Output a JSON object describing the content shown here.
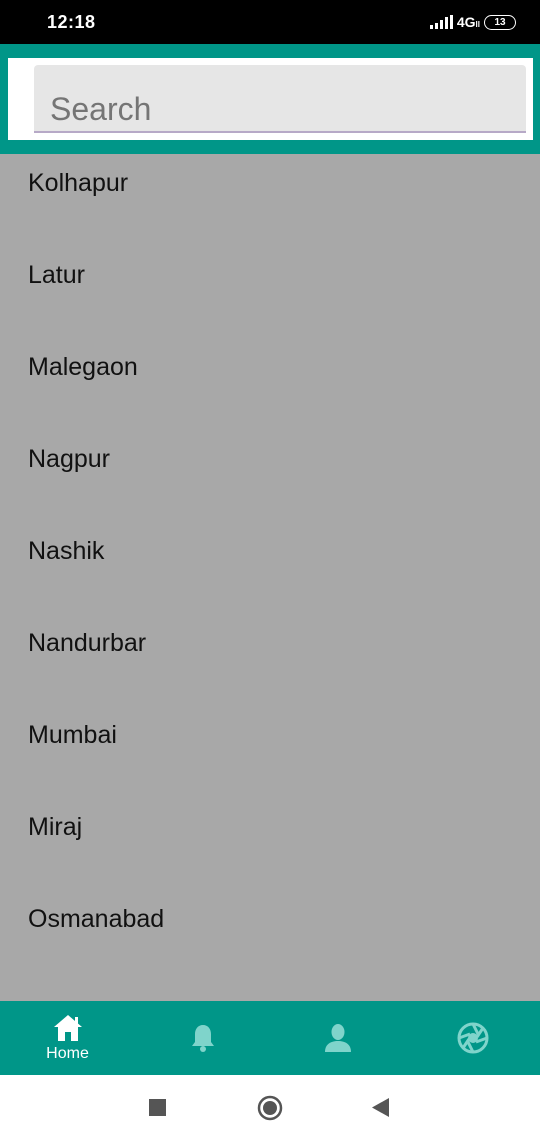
{
  "status_bar": {
    "time": "12:18",
    "network": "4G",
    "battery": "13"
  },
  "search": {
    "placeholder": "Search"
  },
  "cities": [
    "Kolhapur",
    "Latur",
    "Malegaon",
    "Nagpur",
    "Nashik",
    "Nandurbar",
    "Mumbai",
    "Miraj",
    "Osmanabad"
  ],
  "bottom_nav": {
    "items": [
      {
        "icon": "home-icon",
        "label": "Home"
      },
      {
        "icon": "bell-icon",
        "label": ""
      },
      {
        "icon": "person-icon",
        "label": ""
      },
      {
        "icon": "aperture-icon",
        "label": ""
      }
    ]
  },
  "colors": {
    "accent": "#009688",
    "list_background": "#a8a8a8",
    "inactive_icon": "#7fd4cb"
  }
}
